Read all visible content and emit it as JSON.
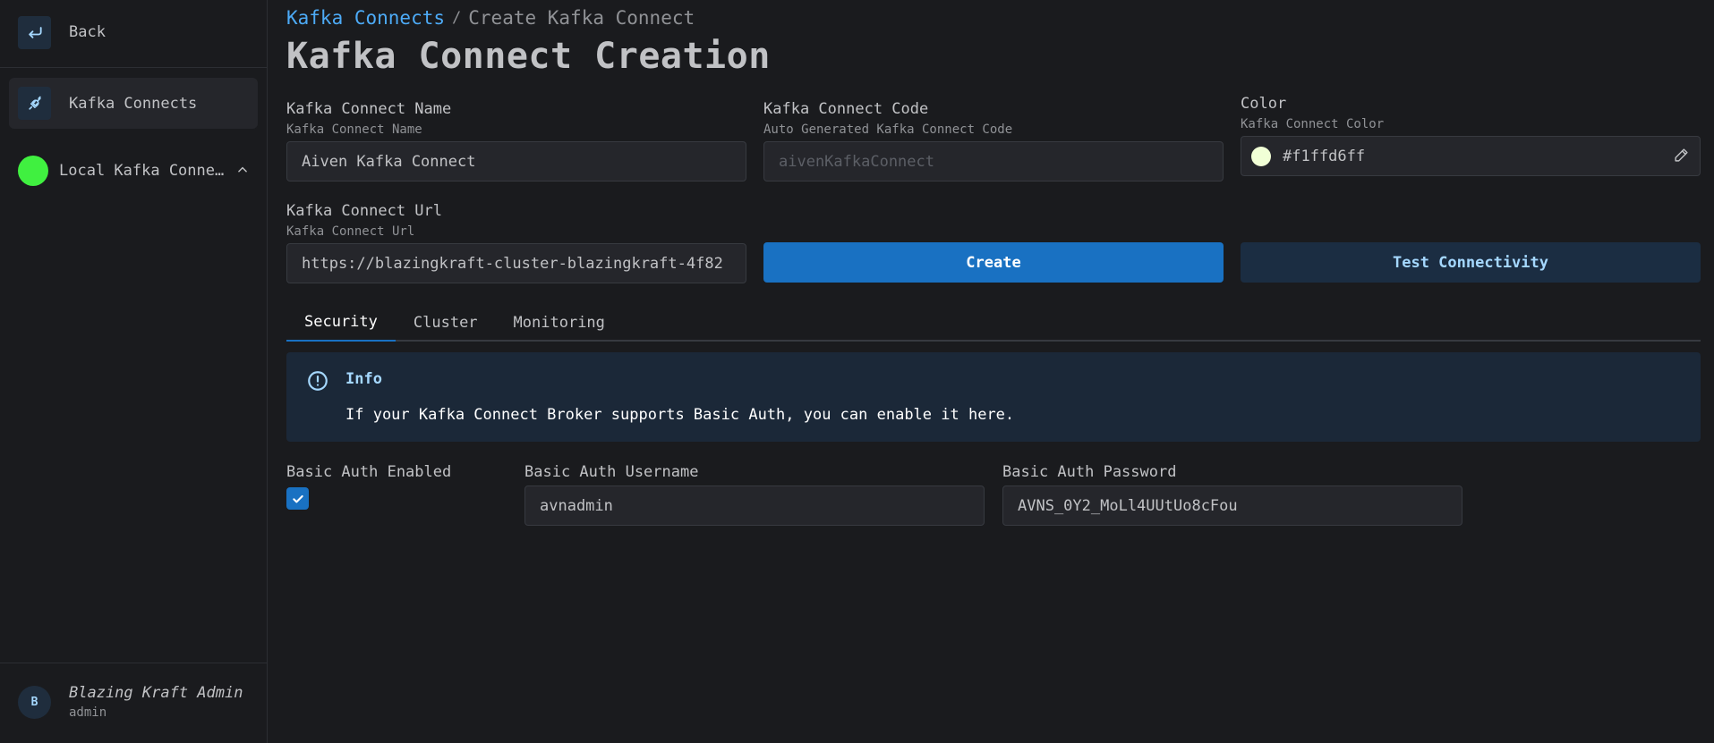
{
  "sidebar": {
    "back_label": "Back",
    "active_item": "Kafka Connects",
    "connection_label": "Local Kafka Connect",
    "user": {
      "avatar_initial": "B",
      "name": "Blazing Kraft Admin",
      "role": "admin"
    }
  },
  "breadcrumb": {
    "link": "Kafka Connects",
    "separator": "/",
    "current": "Create Kafka Connect"
  },
  "page_title": "Kafka Connect Creation",
  "form": {
    "name": {
      "label": "Kafka Connect Name",
      "description": "Kafka Connect Name",
      "value": "Aiven Kafka Connect"
    },
    "code": {
      "label": "Kafka Connect Code",
      "description": "Auto Generated Kafka Connect Code",
      "value": "aivenKafkaConnect"
    },
    "color": {
      "label": "Color",
      "description": "Kafka Connect Color",
      "value": "#f1ffd6ff",
      "swatch": "#f1ffd6"
    },
    "url": {
      "label": "Kafka Connect Url",
      "description": "Kafka Connect Url",
      "value": "https://blazingkraft-cluster-blazingkraft-4f82"
    }
  },
  "buttons": {
    "create": "Create",
    "test": "Test Connectivity"
  },
  "tabs": [
    {
      "label": "Security",
      "active": true
    },
    {
      "label": "Cluster",
      "active": false
    },
    {
      "label": "Monitoring",
      "active": false
    }
  ],
  "info_alert": {
    "title": "Info",
    "message": "If your Kafka Connect Broker supports Basic Auth, you can enable it here."
  },
  "security": {
    "enabled_label": "Basic Auth Enabled",
    "enabled": true,
    "username_label": "Basic Auth Username",
    "username": "avnadmin",
    "password_label": "Basic Auth Password",
    "password": "AVNS_0Y2_MoLl4UUtUo8cFou"
  },
  "colors": {
    "accent": "#1971c2",
    "link": "#4dabf7",
    "connection_dot": "#40f040"
  }
}
